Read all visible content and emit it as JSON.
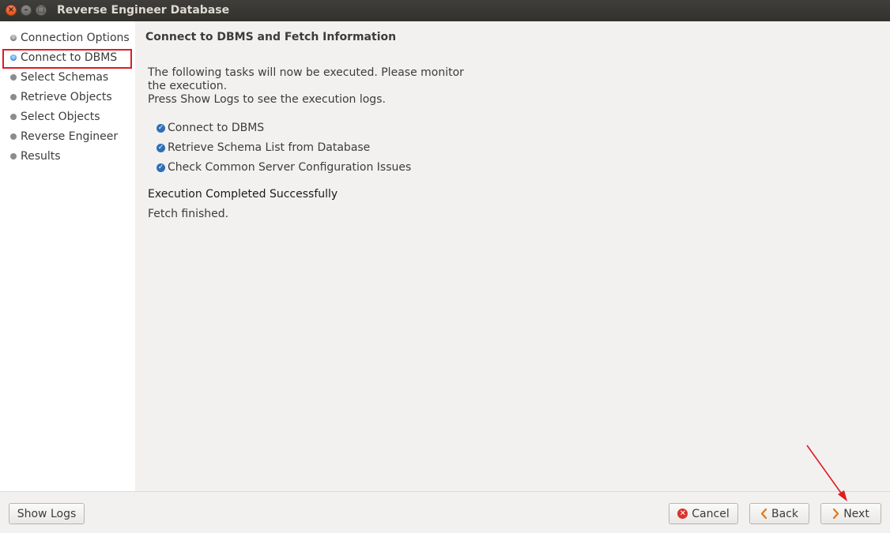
{
  "window": {
    "title": "Reverse Engineer Database",
    "controls": {
      "close": "×",
      "minimize": "–",
      "maximize": "□"
    }
  },
  "sidebar": {
    "steps": [
      {
        "label": "Connection Options",
        "state": "done"
      },
      {
        "label": "Connect to DBMS",
        "state": "active"
      },
      {
        "label": "Select Schemas",
        "state": "pending"
      },
      {
        "label": "Retrieve Objects",
        "state": "pending"
      },
      {
        "label": "Select Objects",
        "state": "pending"
      },
      {
        "label": "Reverse Engineer",
        "state": "pending"
      },
      {
        "label": "Results",
        "state": "pending"
      }
    ]
  },
  "main": {
    "heading": "Connect to DBMS and Fetch Information",
    "description_line1": "The following tasks will now be executed. Please monitor",
    "description_line2": "the execution.",
    "description_line3": "Press Show Logs to see the execution logs.",
    "tasks": [
      {
        "label": "Connect to DBMS",
        "checked": true
      },
      {
        "label": "Retrieve Schema List from Database",
        "checked": true
      },
      {
        "label": "Check Common Server Configuration Issues",
        "checked": true
      }
    ],
    "status": "Execution Completed Successfully",
    "detail": "Fetch finished."
  },
  "footer": {
    "show_logs": "Show Logs",
    "cancel": "Cancel",
    "back": "Back",
    "next": "Next"
  },
  "colors": {
    "highlight": "#e01b24",
    "arrow": "#e01b24",
    "check": "#2f6fb7"
  }
}
